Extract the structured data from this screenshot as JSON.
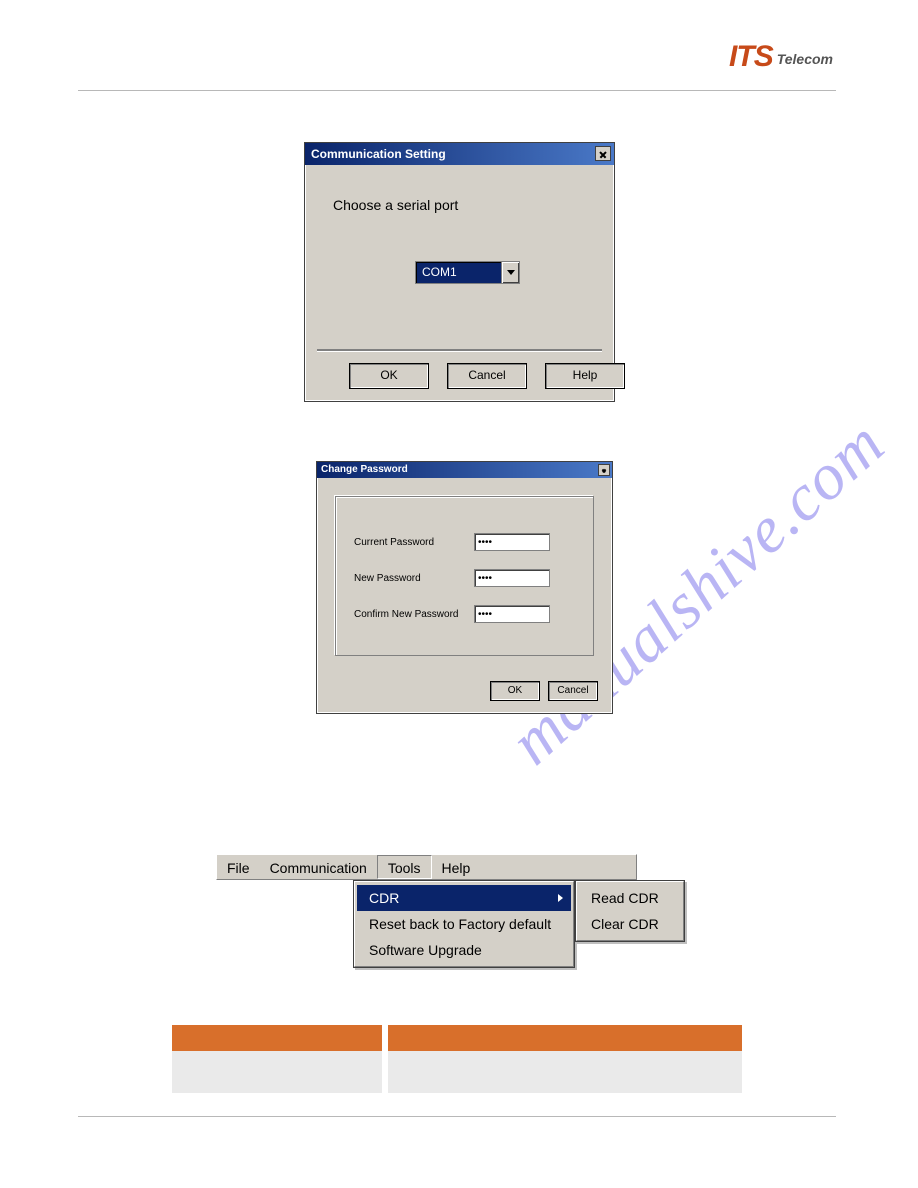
{
  "branding": {
    "logo_main": "ITS",
    "logo_sub": "Telecom"
  },
  "watermark": "manualshive.com",
  "dialog_comm": {
    "title": "Communication Setting",
    "instruction": "Choose a serial port",
    "selected_port": "COM1",
    "buttons": {
      "ok": "OK",
      "cancel": "Cancel",
      "help": "Help"
    }
  },
  "dialog_pw": {
    "title": "Change Password",
    "fields": {
      "current_label": "Current Password",
      "new_label": "New Password",
      "confirm_label": "Confirm New Password",
      "mask": "••••"
    },
    "buttons": {
      "ok": "OK",
      "cancel": "Cancel"
    }
  },
  "menubar": {
    "items": [
      "File",
      "Communication",
      "Tools",
      "Help"
    ],
    "dropdown": {
      "items": [
        {
          "label": "CDR",
          "has_submenu": true,
          "highlighted": true
        },
        {
          "label": "Reset back to Factory default"
        },
        {
          "label": "Software Upgrade"
        }
      ]
    },
    "submenu": {
      "items": [
        "Read CDR",
        "Clear CDR"
      ]
    }
  }
}
